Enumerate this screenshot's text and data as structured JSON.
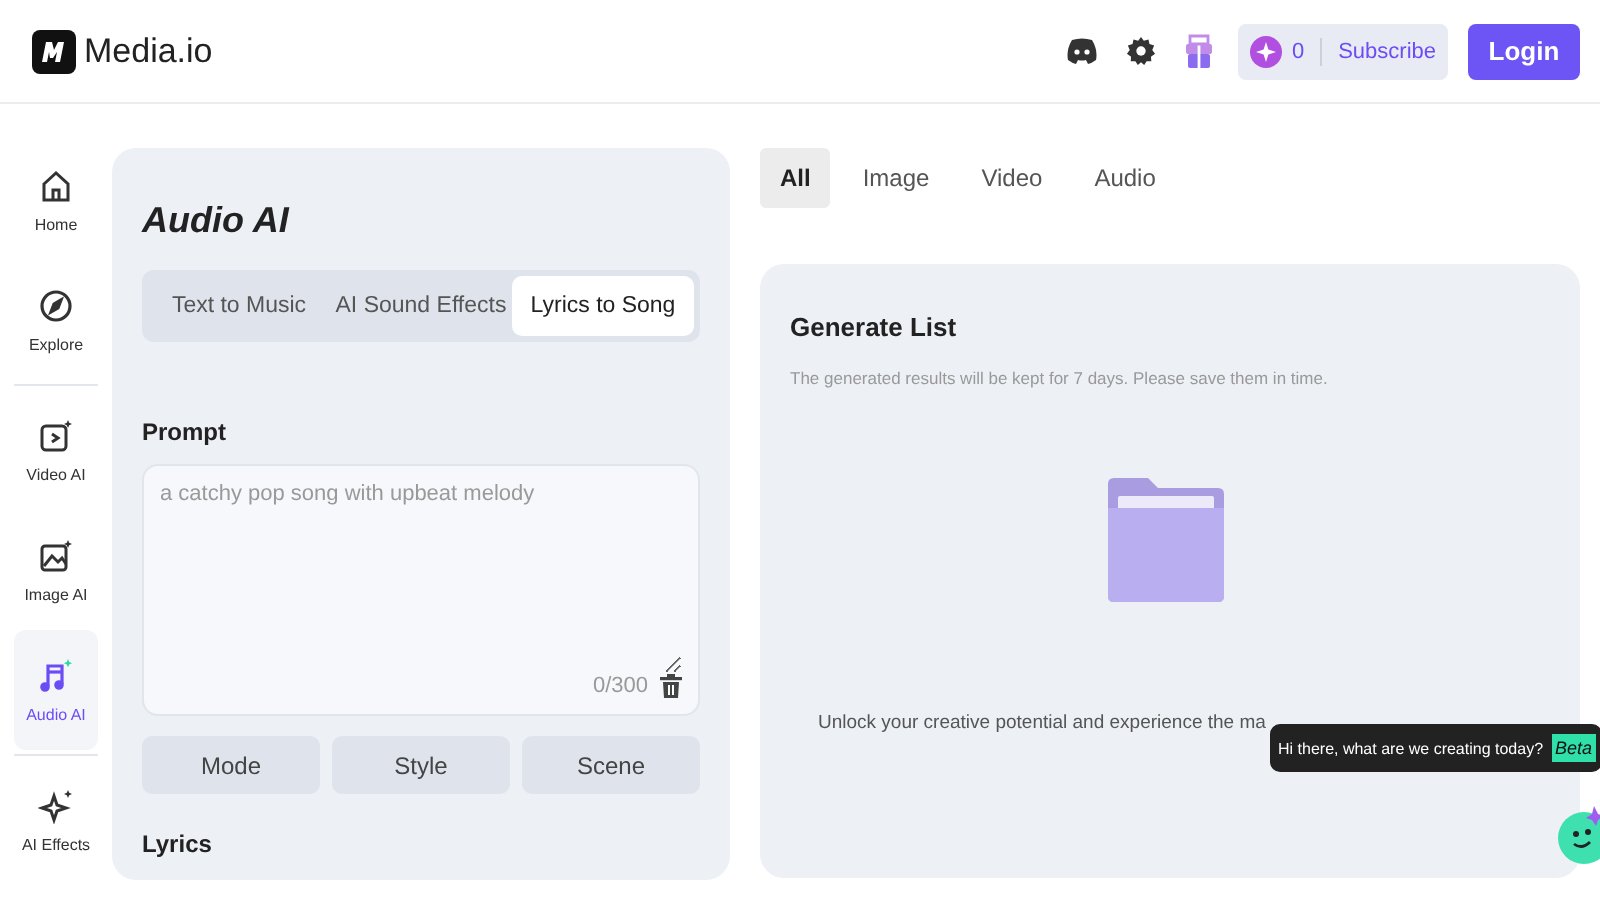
{
  "header": {
    "brand": "Media.io",
    "credits": "0",
    "subscribe": "Subscribe",
    "login": "Login"
  },
  "sidebar": {
    "items": [
      {
        "label": "Home",
        "kind": "home",
        "selected": false,
        "divider": false
      },
      {
        "label": "Explore",
        "kind": "explore",
        "selected": false,
        "divider": true
      },
      {
        "label": "Video AI",
        "kind": "video",
        "selected": false,
        "divider": false
      },
      {
        "label": "Image AI",
        "kind": "image",
        "selected": false,
        "divider": false
      },
      {
        "label": "Audio AI",
        "kind": "audio",
        "selected": true,
        "divider": true
      },
      {
        "label": "AI Effects",
        "kind": "effects",
        "selected": false,
        "divider": false
      }
    ]
  },
  "panel": {
    "title": "Audio AI",
    "tabs": [
      {
        "label": "Text to Music",
        "selected": false
      },
      {
        "label": "AI Sound Effects",
        "selected": false
      },
      {
        "label": "Lyrics to Song",
        "selected": true
      }
    ],
    "prompt_label": "Prompt",
    "prompt": {
      "placeholder": "a catchy pop song with upbeat melody",
      "counter": "0/300"
    },
    "options": [
      "Mode",
      "Style",
      "Scene"
    ],
    "lyrics_label": "Lyrics"
  },
  "results": {
    "tabs": [
      {
        "label": "All",
        "selected": true
      },
      {
        "label": "Image",
        "selected": false
      },
      {
        "label": "Video",
        "selected": false
      },
      {
        "label": "Audio",
        "selected": false
      }
    ],
    "title": "Generate List",
    "note": "The generated results will be kept for 7 days. Please save them in time.",
    "empty_message": "Unlock your creative potential and experience the ma"
  },
  "assistant": {
    "message": "Hi there, what are we creating today?",
    "badge": "Beta"
  }
}
